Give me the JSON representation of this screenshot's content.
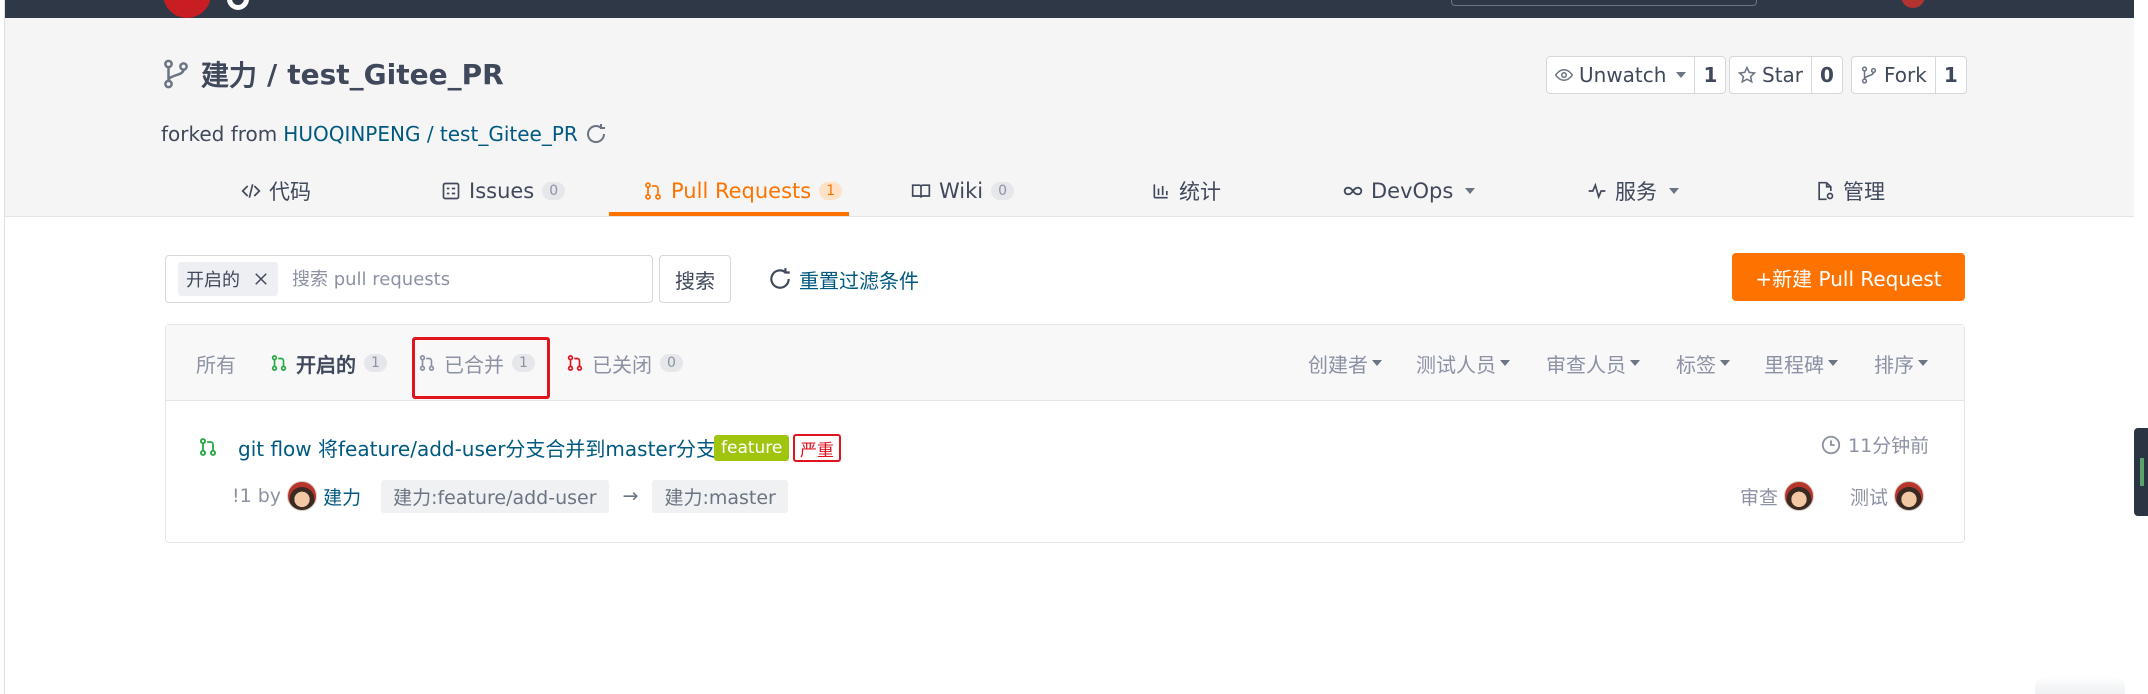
{
  "repo": {
    "owner": "建力",
    "separator": "/",
    "name": "test_Gitee_PR",
    "forked_prefix": "forked from",
    "forked_source": "HUOQINPENG / test_Gitee_PR"
  },
  "social": {
    "watch": {
      "label": "Unwatch",
      "count": "1"
    },
    "star": {
      "label": "Star",
      "count": "0"
    },
    "fork": {
      "label": "Fork",
      "count": "1"
    }
  },
  "nav": {
    "code": "代码",
    "issues": {
      "label": "Issues",
      "count": "0"
    },
    "pulls": {
      "label": "Pull Requests",
      "count": "1"
    },
    "wiki": {
      "label": "Wiki",
      "count": "0"
    },
    "stats": "统计",
    "devops": "DevOps",
    "services": "服务",
    "manage": "管理"
  },
  "filter": {
    "chip": "开启的",
    "placeholder": "搜索 pull requests",
    "search_button": "搜索",
    "reset": "重置过滤条件",
    "new_pr": "+新建 Pull Request"
  },
  "states": {
    "all": "所有",
    "open": {
      "label": "开启的",
      "count": "1"
    },
    "merged": {
      "label": "已合并",
      "count": "1"
    },
    "closed": {
      "label": "已关闭",
      "count": "0"
    }
  },
  "dropdowns": [
    "创建者",
    "测试人员",
    "审查人员",
    "标签",
    "里程碑",
    "排序"
  ],
  "pr": {
    "title": "git flow 将feature/add-user分支合并到master分支",
    "labels": [
      "feature",
      "严重"
    ],
    "time": "11分钟前",
    "number": "!1 by",
    "author": "建力",
    "source_branch": "建力:feature/add-user",
    "arrow": "→",
    "target_branch": "建力:master",
    "reviewer_label": "审查",
    "tester_label": "测试"
  },
  "colors": {
    "accent": "#fe7300",
    "link": "#005980",
    "feature_label": "#a0c50f",
    "severe_label": "#e0141e",
    "open_icon": "#27a844",
    "closed_icon": "#e0141e"
  }
}
